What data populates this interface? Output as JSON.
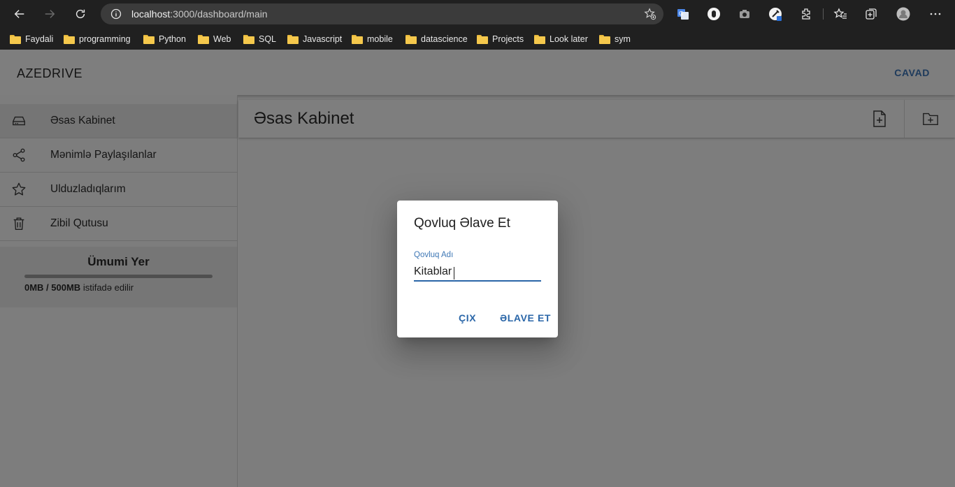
{
  "browser": {
    "url_host": "localhost",
    "url_path": ":3000/dashboard/main",
    "bookmarks": [
      "Faydali",
      "programming",
      "Python",
      "Web",
      "SQL",
      "Javascript",
      "mobile",
      "datascience",
      "Projects",
      "Look later",
      "sym"
    ]
  },
  "header": {
    "title": "AZEDRIVE",
    "user": "CAVAD"
  },
  "sidebar": {
    "items": [
      {
        "label": "Əsas Kabinet",
        "icon": "drive-icon"
      },
      {
        "label": "Mənimlə Paylaşılanlar",
        "icon": "share-icon"
      },
      {
        "label": "Ulduzladıqlarım",
        "icon": "star-icon"
      },
      {
        "label": "Zibil Qutusu",
        "icon": "trash-icon"
      }
    ],
    "storage": {
      "title": "Ümumi Yer",
      "used": "0MB / 500MB",
      "suffix": "istifadə edilir",
      "fraction": 0
    }
  },
  "main": {
    "title": "Əsas Kabinet"
  },
  "dialog": {
    "title": "Qovluq Əlave Et",
    "field_label": "Qovluq Adı",
    "field_value": "Kitablar",
    "cancel": "ÇIX",
    "submit": "ƏLAVE ET"
  },
  "colors": {
    "accent": "#2a66a8",
    "chrome": "#202020"
  }
}
